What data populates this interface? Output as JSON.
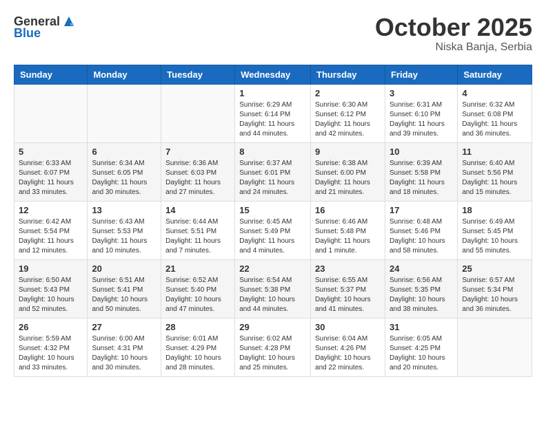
{
  "header": {
    "logo": {
      "general": "General",
      "blue": "Blue"
    },
    "title": "October 2025",
    "location": "Niska Banja, Serbia"
  },
  "weekdays": [
    "Sunday",
    "Monday",
    "Tuesday",
    "Wednesday",
    "Thursday",
    "Friday",
    "Saturday"
  ],
  "weeks": [
    [
      {
        "day": "",
        "info": ""
      },
      {
        "day": "",
        "info": ""
      },
      {
        "day": "",
        "info": ""
      },
      {
        "day": "1",
        "info": "Sunrise: 6:29 AM\nSunset: 6:14 PM\nDaylight: 11 hours\nand 44 minutes."
      },
      {
        "day": "2",
        "info": "Sunrise: 6:30 AM\nSunset: 6:12 PM\nDaylight: 11 hours\nand 42 minutes."
      },
      {
        "day": "3",
        "info": "Sunrise: 6:31 AM\nSunset: 6:10 PM\nDaylight: 11 hours\nand 39 minutes."
      },
      {
        "day": "4",
        "info": "Sunrise: 6:32 AM\nSunset: 6:08 PM\nDaylight: 11 hours\nand 36 minutes."
      }
    ],
    [
      {
        "day": "5",
        "info": "Sunrise: 6:33 AM\nSunset: 6:07 PM\nDaylight: 11 hours\nand 33 minutes."
      },
      {
        "day": "6",
        "info": "Sunrise: 6:34 AM\nSunset: 6:05 PM\nDaylight: 11 hours\nand 30 minutes."
      },
      {
        "day": "7",
        "info": "Sunrise: 6:36 AM\nSunset: 6:03 PM\nDaylight: 11 hours\nand 27 minutes."
      },
      {
        "day": "8",
        "info": "Sunrise: 6:37 AM\nSunset: 6:01 PM\nDaylight: 11 hours\nand 24 minutes."
      },
      {
        "day": "9",
        "info": "Sunrise: 6:38 AM\nSunset: 6:00 PM\nDaylight: 11 hours\nand 21 minutes."
      },
      {
        "day": "10",
        "info": "Sunrise: 6:39 AM\nSunset: 5:58 PM\nDaylight: 11 hours\nand 18 minutes."
      },
      {
        "day": "11",
        "info": "Sunrise: 6:40 AM\nSunset: 5:56 PM\nDaylight: 11 hours\nand 15 minutes."
      }
    ],
    [
      {
        "day": "12",
        "info": "Sunrise: 6:42 AM\nSunset: 5:54 PM\nDaylight: 11 hours\nand 12 minutes."
      },
      {
        "day": "13",
        "info": "Sunrise: 6:43 AM\nSunset: 5:53 PM\nDaylight: 11 hours\nand 10 minutes."
      },
      {
        "day": "14",
        "info": "Sunrise: 6:44 AM\nSunset: 5:51 PM\nDaylight: 11 hours\nand 7 minutes."
      },
      {
        "day": "15",
        "info": "Sunrise: 6:45 AM\nSunset: 5:49 PM\nDaylight: 11 hours\nand 4 minutes."
      },
      {
        "day": "16",
        "info": "Sunrise: 6:46 AM\nSunset: 5:48 PM\nDaylight: 11 hours\nand 1 minute."
      },
      {
        "day": "17",
        "info": "Sunrise: 6:48 AM\nSunset: 5:46 PM\nDaylight: 10 hours\nand 58 minutes."
      },
      {
        "day": "18",
        "info": "Sunrise: 6:49 AM\nSunset: 5:45 PM\nDaylight: 10 hours\nand 55 minutes."
      }
    ],
    [
      {
        "day": "19",
        "info": "Sunrise: 6:50 AM\nSunset: 5:43 PM\nDaylight: 10 hours\nand 52 minutes."
      },
      {
        "day": "20",
        "info": "Sunrise: 6:51 AM\nSunset: 5:41 PM\nDaylight: 10 hours\nand 50 minutes."
      },
      {
        "day": "21",
        "info": "Sunrise: 6:52 AM\nSunset: 5:40 PM\nDaylight: 10 hours\nand 47 minutes."
      },
      {
        "day": "22",
        "info": "Sunrise: 6:54 AM\nSunset: 5:38 PM\nDaylight: 10 hours\nand 44 minutes."
      },
      {
        "day": "23",
        "info": "Sunrise: 6:55 AM\nSunset: 5:37 PM\nDaylight: 10 hours\nand 41 minutes."
      },
      {
        "day": "24",
        "info": "Sunrise: 6:56 AM\nSunset: 5:35 PM\nDaylight: 10 hours\nand 38 minutes."
      },
      {
        "day": "25",
        "info": "Sunrise: 6:57 AM\nSunset: 5:34 PM\nDaylight: 10 hours\nand 36 minutes."
      }
    ],
    [
      {
        "day": "26",
        "info": "Sunrise: 5:59 AM\nSunset: 4:32 PM\nDaylight: 10 hours\nand 33 minutes."
      },
      {
        "day": "27",
        "info": "Sunrise: 6:00 AM\nSunset: 4:31 PM\nDaylight: 10 hours\nand 30 minutes."
      },
      {
        "day": "28",
        "info": "Sunrise: 6:01 AM\nSunset: 4:29 PM\nDaylight: 10 hours\nand 28 minutes."
      },
      {
        "day": "29",
        "info": "Sunrise: 6:02 AM\nSunset: 4:28 PM\nDaylight: 10 hours\nand 25 minutes."
      },
      {
        "day": "30",
        "info": "Sunrise: 6:04 AM\nSunset: 4:26 PM\nDaylight: 10 hours\nand 22 minutes."
      },
      {
        "day": "31",
        "info": "Sunrise: 6:05 AM\nSunset: 4:25 PM\nDaylight: 10 hours\nand 20 minutes."
      },
      {
        "day": "",
        "info": ""
      }
    ]
  ]
}
